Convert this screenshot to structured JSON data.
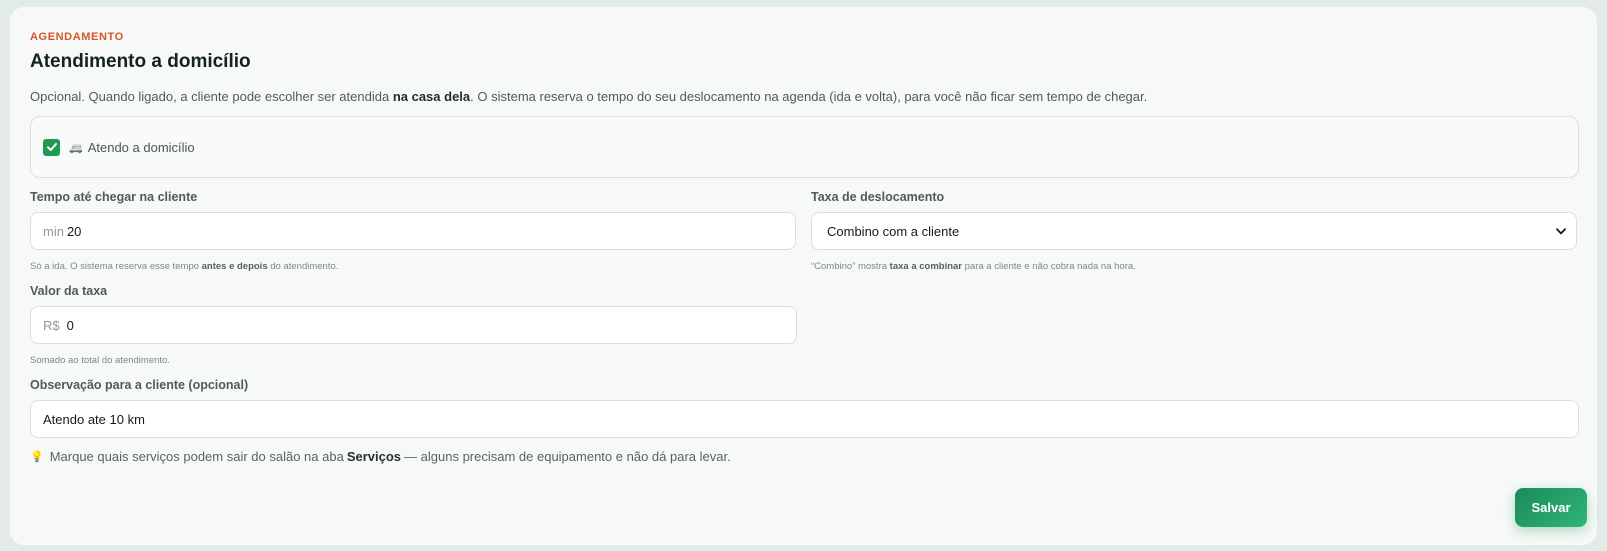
{
  "section": {
    "eyebrow": "AGENDAMENTO",
    "title": "Atendimento a domicílio",
    "description_pre": "Opcional. Quando ligado, a cliente pode escolher ser atendida ",
    "description_bold": "na casa dela",
    "description_post": ". O sistema reserva o tempo do seu deslocamento na agenda (ida e volta), para você não ficar sem tempo de chegar."
  },
  "toggle": {
    "checked": true,
    "icon": "van-emoji",
    "label": "Atendo a domicílio"
  },
  "travel_time": {
    "label": "Tempo até chegar na cliente",
    "prefix": "min",
    "value": "20",
    "hint_pre": "Só a ida. O sistema reserva esse tempo ",
    "hint_bold": "antes e depois",
    "hint_post": " do atendimento."
  },
  "travel_fee": {
    "label": "Taxa de deslocamento",
    "selected": "Combino com a cliente",
    "hint_pre": "“Combino” mostra ",
    "hint_bold": "taxa a combinar",
    "hint_post": " para a cliente e não cobra nada na hora."
  },
  "fee_value": {
    "label": "Valor da taxa",
    "prefix": "R$",
    "value": "0",
    "hint": "Somado ao total do atendimento."
  },
  "note": {
    "label": "Observação para a cliente (opcional)",
    "value": "Atendo ate 10 km"
  },
  "tip": {
    "icon": "lightbulb-emoji",
    "pre": "Marque quais serviços podem sair do salão na aba",
    "bold": "Serviços",
    "post": "— alguns precisam de equipamento e não dá para levar."
  },
  "actions": {
    "save_label": "Salvar"
  },
  "colors": {
    "accent": "#1f9a55",
    "eyebrow": "#d4552a"
  }
}
